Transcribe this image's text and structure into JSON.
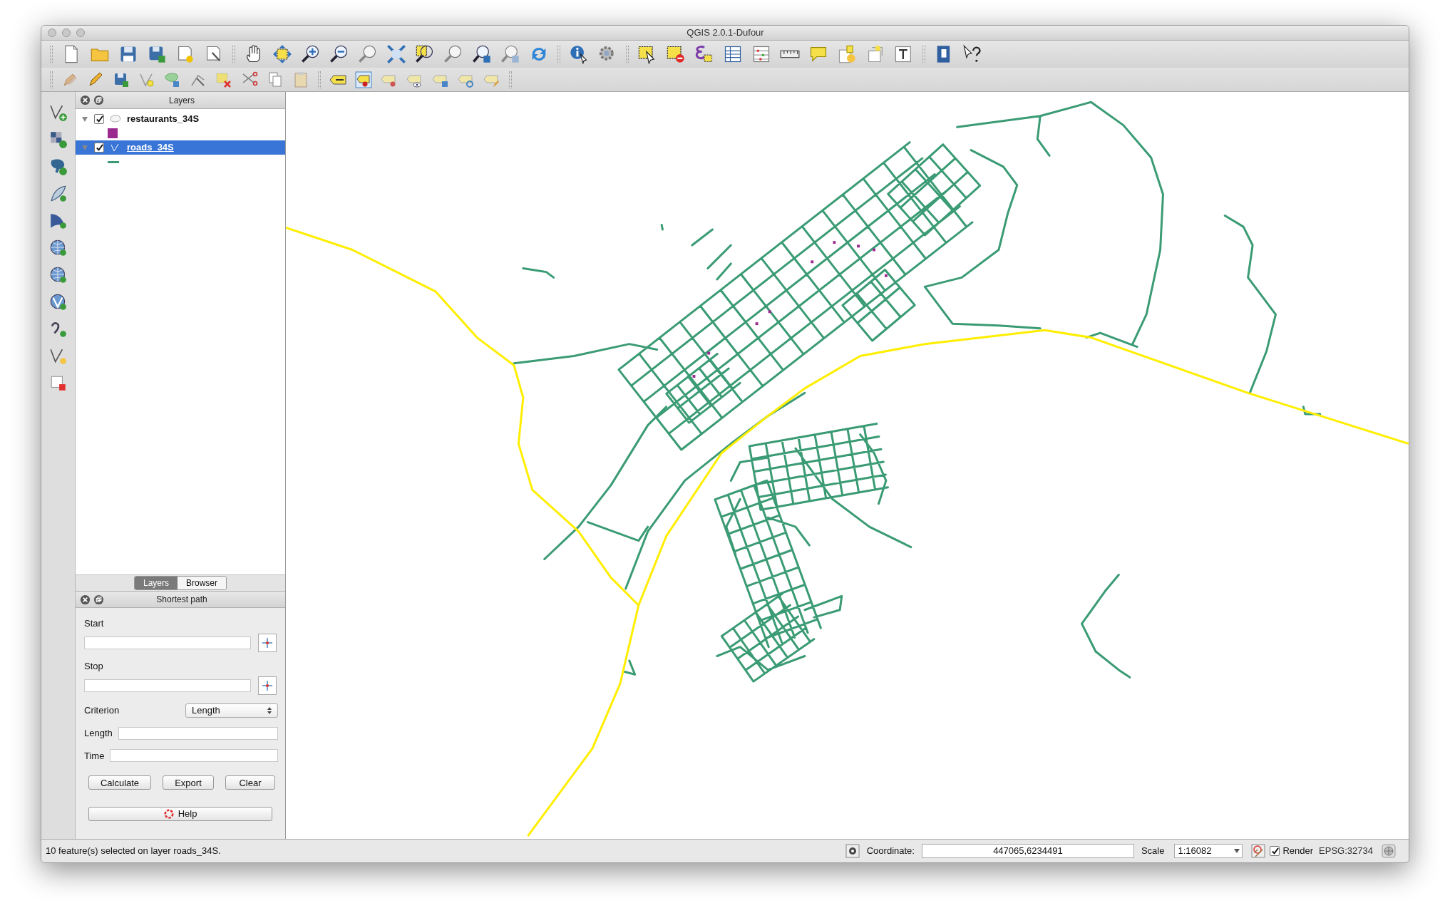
{
  "window": {
    "title": "QGIS 2.0.1-Dufour"
  },
  "layers_panel": {
    "title": "Layers",
    "layers": [
      {
        "name": "restaurants_34S",
        "kind": "point",
        "expanded": true,
        "checked": true,
        "selected": false,
        "color": "#9b2a8f"
      },
      {
        "name": "roads_34S",
        "kind": "line",
        "expanded": true,
        "checked": true,
        "selected": true,
        "color": "#3a9b74"
      }
    ]
  },
  "panel_tabs": [
    {
      "label": "Layers",
      "selected": true
    },
    {
      "label": "Browser",
      "selected": false
    }
  ],
  "shortest_path": {
    "title": "Shortest path",
    "start": {
      "label": "Start"
    },
    "stop": {
      "label": "Stop"
    },
    "criterion": {
      "label": "Criterion",
      "value": "Length"
    },
    "length": {
      "label": "Length"
    },
    "time": {
      "label": "Time"
    },
    "buttons": [
      "Calculate",
      "Export",
      "Clear"
    ],
    "help": "Help"
  },
  "status_bar": {
    "message": "10 feature(s) selected on layer roads_34S.",
    "coordinate_label": "Coordinate:",
    "coordinate": "447065,6234491",
    "scale_label": "Scale",
    "scale": "1:16082",
    "render": {
      "label": "Render",
      "checked": true
    },
    "crs": "EPSG:32734"
  }
}
